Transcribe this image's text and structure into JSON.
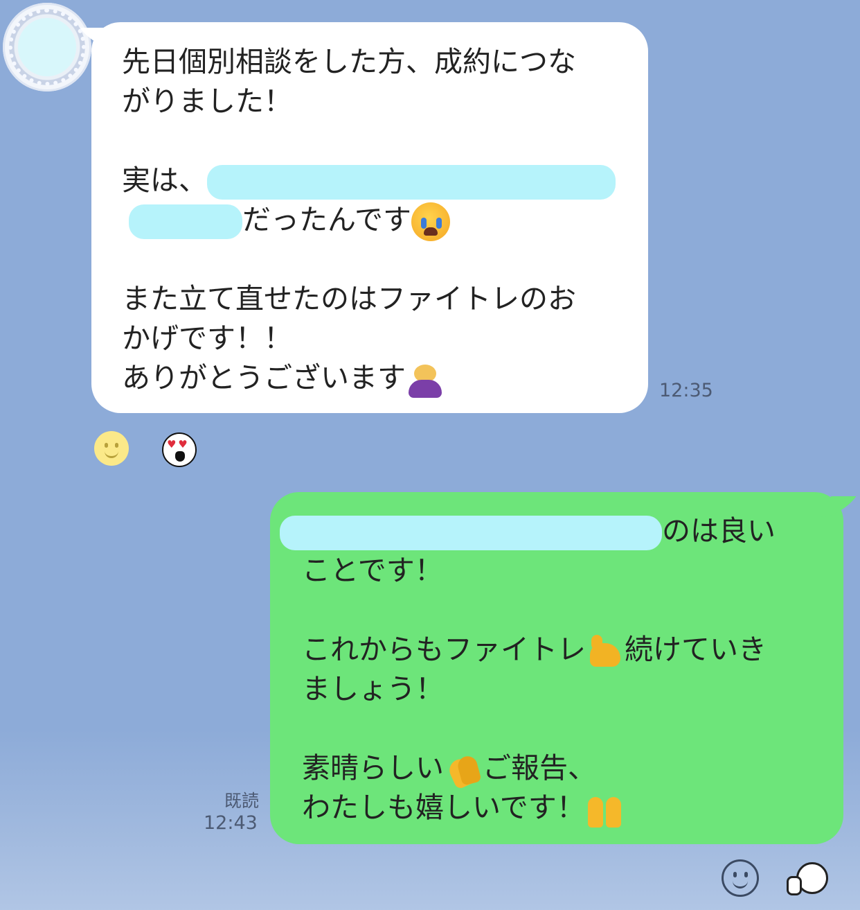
{
  "colors": {
    "background": "#8dabd8",
    "incoming_bubble": "#ffffff",
    "outgoing_bubble": "#6de57a",
    "redaction": "#b6f3fb"
  },
  "incoming": {
    "lines": {
      "l1": "先日個別相談をした方、成約につな",
      "l2": "がりました！",
      "l3_prefix": "実は、",
      "l4_text": "だったんです",
      "l5": "また立て直せたのはファイトレのお",
      "l6": "かげです！！",
      "l7": "ありがとうございます"
    },
    "emoji": {
      "crying": "loudly-crying-face",
      "bow": "person-bowing"
    },
    "time": "12:35",
    "reactions": [
      "smile-reaction",
      "heart-eyes-reaction"
    ]
  },
  "outgoing": {
    "lines": {
      "l1_suffix": "のは良い",
      "l2": "ことです！",
      "l3_a": "これからもファイトレ",
      "l3_b": "続けていき",
      "l4": "ましょう！",
      "l5_a": "素晴らしい",
      "l5_b": "ご報告、",
      "l6": "わたしも嬉しいです！"
    },
    "emoji": {
      "muscle": "flexed-biceps",
      "clap": "clapping-hands",
      "raise": "raising-hands"
    },
    "read_label": "既読",
    "time": "12:43"
  },
  "footer_icons": [
    "emoji-icon",
    "sticker-icon"
  ]
}
